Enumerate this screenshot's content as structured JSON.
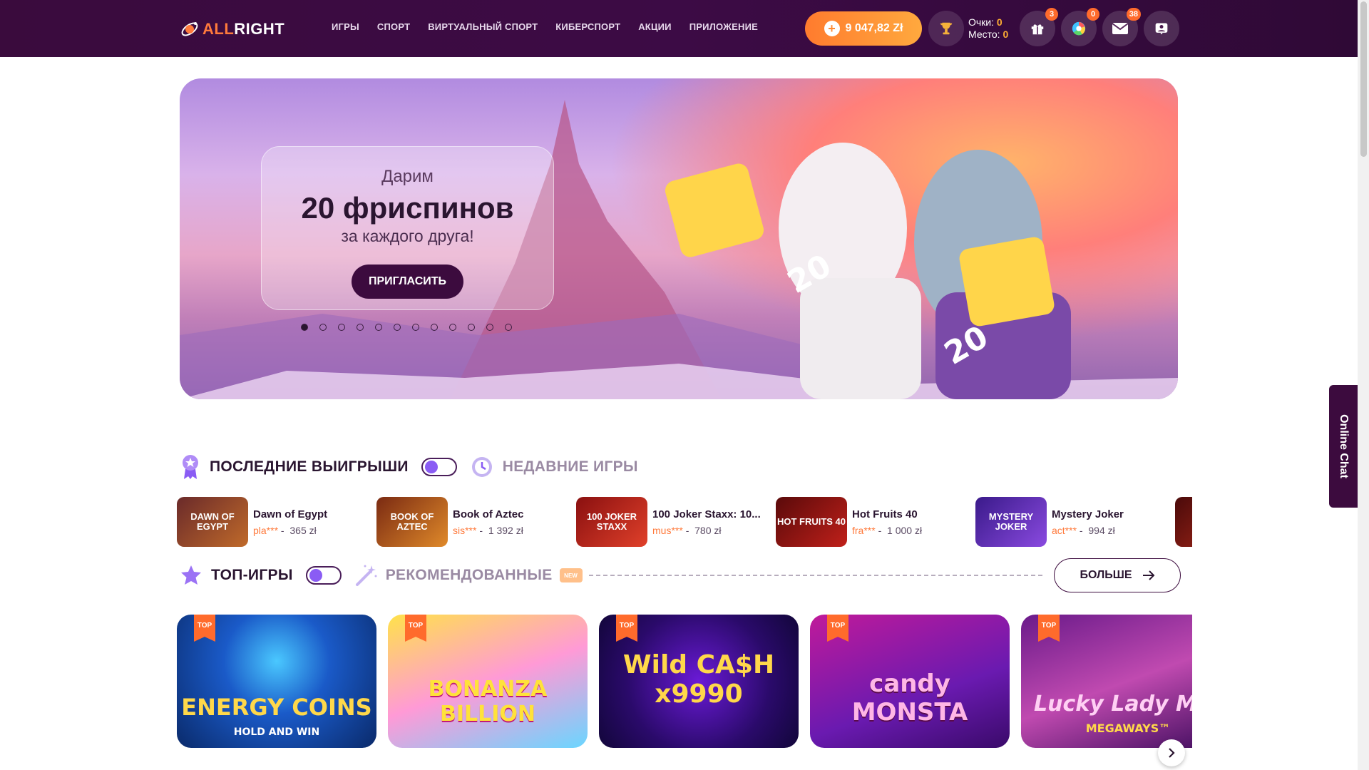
{
  "header": {
    "logo": {
      "accent": "ALL",
      "rest": "RIGHT"
    },
    "nav": [
      "ИГРЫ",
      "СПОРТ",
      "ВИРТУАЛЬНЫЙ СПОРТ",
      "КИБЕРСПОРТ",
      "АКЦИИ",
      "ПРИЛОЖЕНИЕ"
    ],
    "balance": "9 047,82 Zł",
    "score": {
      "points_label": "Очки:",
      "points": "0",
      "place_label": "Место:",
      "place": "0"
    },
    "badges": {
      "gifts": "3",
      "wheel": "0",
      "messages": "38"
    }
  },
  "banner": {
    "line1": "Дарим",
    "line2": "20 фриспинов",
    "line3": "за каждого друга!",
    "button": "ПРИГЛАСИТЬ",
    "fs_tag": "20 FS",
    "slides": 12,
    "active_slide": 1
  },
  "wins_section": {
    "title": "ПОСЛЕДНИЕ ВЫИГРЫШИ",
    "alt_title": "НЕДАВНИЕ ИГРЫ",
    "items": [
      {
        "game": "Dawn of Egypt",
        "user": "pla***",
        "sep": "-",
        "amount": "365 zł",
        "thumb": "DAWN OF EGYPT"
      },
      {
        "game": "Book of Aztec",
        "user": "sis***",
        "sep": "-",
        "amount": "1 392 zł",
        "thumb": "BOOK OF AZTEC"
      },
      {
        "game": "100 Joker Staxx: 10...",
        "user": "mus***",
        "sep": "-",
        "amount": "780 zł",
        "thumb": "100 JOKER STAXX"
      },
      {
        "game": "Hot Fruits 40",
        "user": "fra***",
        "sep": "-",
        "amount": "1 000 zł",
        "thumb": "HOT FRUITS 40"
      },
      {
        "game": "Mystery Joker",
        "user": "act***",
        "sep": "-",
        "amount": "994 zł",
        "thumb": "MYSTERY JOKER"
      }
    ]
  },
  "top_section": {
    "title": "ТОП-ИГРЫ",
    "alt_title": "РЕКОМЕНДОВАННЫЕ",
    "new_badge": "NEW",
    "more_button": "БОЛЬШЕ",
    "games": [
      {
        "tag": "TOP",
        "title": "ENERGY COINS",
        "subtitle": "HOLD AND WIN"
      },
      {
        "tag": "TOP",
        "title": "BONANZA BILLION",
        "subtitle": ""
      },
      {
        "tag": "TOP",
        "title": "Wild CA$H x9990",
        "subtitle": ""
      },
      {
        "tag": "TOP",
        "title": "candy MONSTA",
        "subtitle": ""
      },
      {
        "tag": "TOP",
        "title": "Lucky Lady Mo",
        "subtitle": "MEGAWAYS™"
      }
    ]
  },
  "online_chat": "Online Chat"
}
